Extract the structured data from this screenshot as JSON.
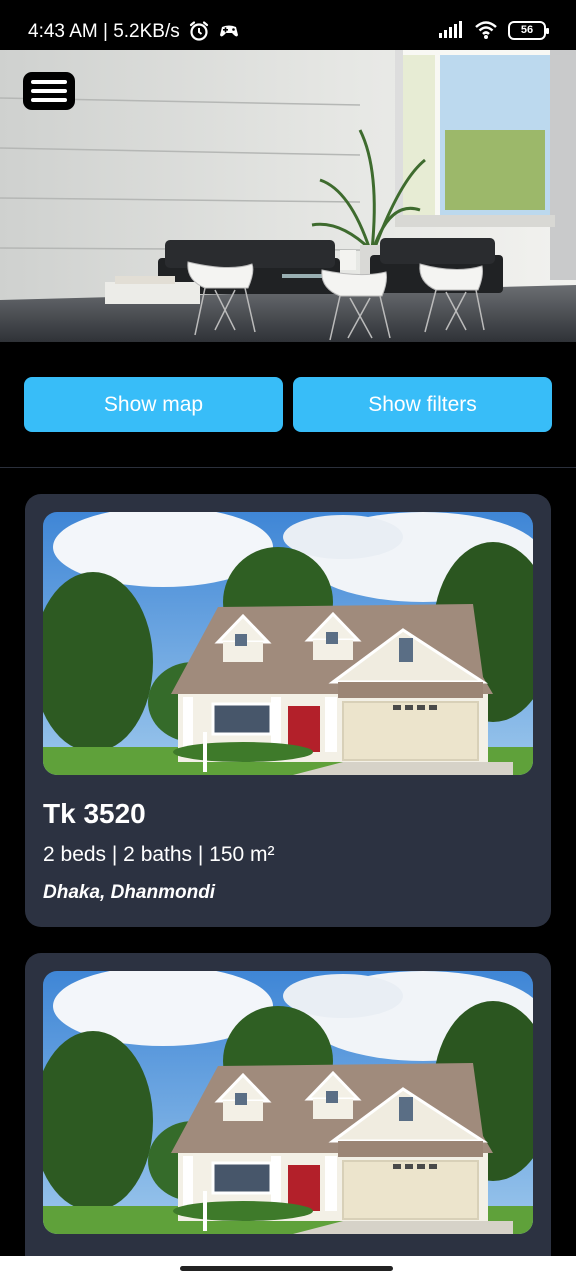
{
  "status_bar": {
    "time_speed": "4:43 AM | 5.2KB/s",
    "battery": "56"
  },
  "hero": {
    "menu_icon": "hamburger-menu-icon"
  },
  "actions": {
    "show_map": "Show map",
    "show_filters": "Show filters"
  },
  "listings": [
    {
      "price": "Tk 3520",
      "specs": "2 beds | 2 baths | 150 m²",
      "location": "Dhaka, Dhanmondi"
    },
    {
      "price": "",
      "specs": "",
      "location": ""
    }
  ],
  "colors": {
    "accent": "#38bdf8",
    "card_bg": "#2c3241",
    "page_bg": "#000000"
  }
}
